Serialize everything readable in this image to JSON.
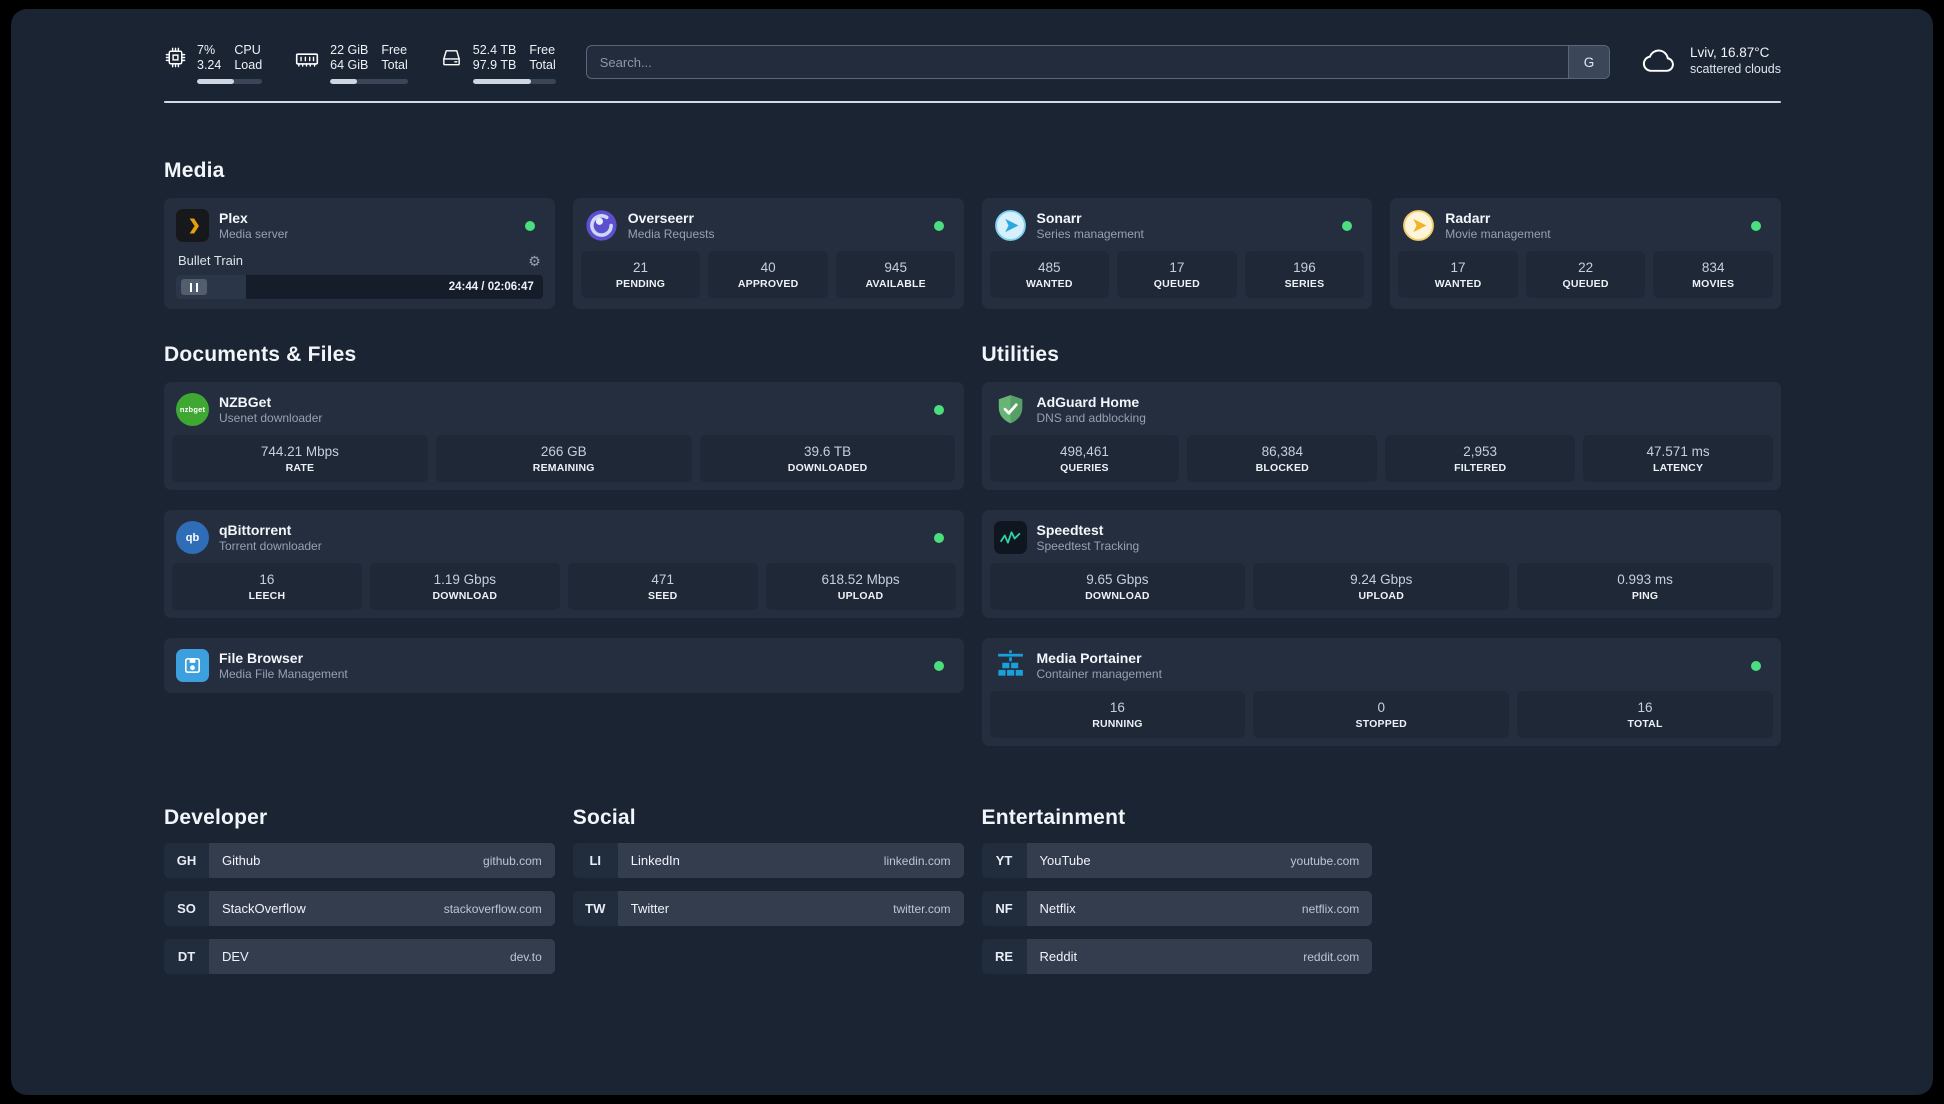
{
  "colors": {
    "status_online": "#4ade80",
    "plex_accent": "#e5a00d",
    "overseerr_accent": "#5d4fd0",
    "sonarr_accent": "#2da8dd",
    "radarr_accent": "#f0b429",
    "nzbget_accent": "#3fa832",
    "qbittorrent_accent": "#2f6db8",
    "filebrowser_accent": "#3ba0dd",
    "adguard_accent": "#66b574",
    "speedtest_accent": "#2dd4a7",
    "portainer_accent": "#1a9fd9"
  },
  "topbar": {
    "cpu": {
      "values": [
        "7%",
        "3.24"
      ],
      "labels": [
        "CPU",
        "Load"
      ]
    },
    "memory": {
      "values": [
        "22 GiB",
        "64 GiB"
      ],
      "labels": [
        "Free",
        "Total"
      ]
    },
    "disk": {
      "values": [
        "52.4 TB",
        "97.9 TB"
      ],
      "labels": [
        "Free",
        "Total"
      ]
    },
    "search": {
      "placeholder": "Search...",
      "provider": "G"
    },
    "weather": {
      "location": "Lviv, 16.87°C",
      "condition": "scattered clouds"
    }
  },
  "sections": {
    "media": {
      "title": "Media",
      "services": [
        {
          "name": "Plex",
          "desc": "Media server",
          "player": {
            "title": "Bullet Train",
            "time": "24:44 / 02:06:47"
          }
        },
        {
          "name": "Overseerr",
          "desc": "Media Requests",
          "stats": [
            {
              "value": "21",
              "label": "PENDING"
            },
            {
              "value": "40",
              "label": "APPROVED"
            },
            {
              "value": "945",
              "label": "AVAILABLE"
            }
          ]
        },
        {
          "name": "Sonarr",
          "desc": "Series management",
          "stats": [
            {
              "value": "485",
              "label": "WANTED"
            },
            {
              "value": "17",
              "label": "QUEUED"
            },
            {
              "value": "196",
              "label": "SERIES"
            }
          ]
        },
        {
          "name": "Radarr",
          "desc": "Movie management",
          "stats": [
            {
              "value": "17",
              "label": "WANTED"
            },
            {
              "value": "22",
              "label": "QUEUED"
            },
            {
              "value": "834",
              "label": "MOVIES"
            }
          ]
        }
      ]
    },
    "documents": {
      "title": "Documents & Files",
      "services": [
        {
          "name": "NZBGet",
          "desc": "Usenet downloader",
          "icon_text": "nzbget",
          "stats": [
            {
              "value": "744.21 Mbps",
              "label": "RATE"
            },
            {
              "value": "266 GB",
              "label": "REMAINING"
            },
            {
              "value": "39.6 TB",
              "label": "DOWNLOADED"
            }
          ]
        },
        {
          "name": "qBittorrent",
          "desc": "Torrent downloader",
          "icon_text": "qb",
          "stats": [
            {
              "value": "16",
              "label": "LEECH"
            },
            {
              "value": "1.19 Gbps",
              "label": "DOWNLOAD"
            },
            {
              "value": "471",
              "label": "SEED"
            },
            {
              "value": "618.52 Mbps",
              "label": "UPLOAD"
            }
          ]
        },
        {
          "name": "File Browser",
          "desc": "Media File Management"
        }
      ]
    },
    "utilities": {
      "title": "Utilities",
      "services": [
        {
          "name": "AdGuard Home",
          "desc": "DNS and adblocking",
          "stats": [
            {
              "value": "498,461",
              "label": "QUERIES"
            },
            {
              "value": "86,384",
              "label": "BLOCKED"
            },
            {
              "value": "2,953",
              "label": "FILTERED"
            },
            {
              "value": "47.571 ms",
              "label": "LATENCY"
            }
          ]
        },
        {
          "name": "Speedtest",
          "desc": "Speedtest Tracking",
          "stats": [
            {
              "value": "9.65 Gbps",
              "label": "DOWNLOAD"
            },
            {
              "value": "9.24 Gbps",
              "label": "UPLOAD"
            },
            {
              "value": "0.993 ms",
              "label": "PING"
            }
          ]
        },
        {
          "name": "Media Portainer",
          "desc": "Container management",
          "stats": [
            {
              "value": "16",
              "label": "RUNNING"
            },
            {
              "value": "0",
              "label": "STOPPED"
            },
            {
              "value": "16",
              "label": "TOTAL"
            }
          ]
        }
      ]
    }
  },
  "bookmarks": [
    {
      "title": "Developer",
      "items": [
        {
          "abbr": "GH",
          "name": "Github",
          "url": "github.com"
        },
        {
          "abbr": "SO",
          "name": "StackOverflow",
          "url": "stackoverflow.com"
        },
        {
          "abbr": "DT",
          "name": "DEV",
          "url": "dev.to"
        }
      ]
    },
    {
      "title": "Social",
      "items": [
        {
          "abbr": "LI",
          "name": "LinkedIn",
          "url": "linkedin.com"
        },
        {
          "abbr": "TW",
          "name": "Twitter",
          "url": "twitter.com"
        }
      ]
    },
    {
      "title": "Entertainment",
      "items": [
        {
          "abbr": "YT",
          "name": "YouTube",
          "url": "youtube.com"
        },
        {
          "abbr": "NF",
          "name": "Netflix",
          "url": "netflix.com"
        },
        {
          "abbr": "RE",
          "name": "Reddit",
          "url": "reddit.com"
        }
      ]
    }
  ]
}
